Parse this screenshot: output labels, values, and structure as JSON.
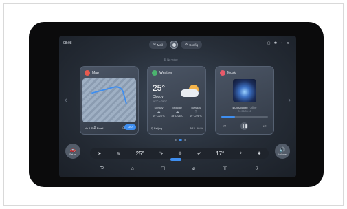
{
  "status": {
    "time": "08:08",
    "system_icons": "▢ ✱ ◔ ≋"
  },
  "top": {
    "mail_label": "Mail",
    "config_label": "Config"
  },
  "voice": {
    "hint": "No voice"
  },
  "map": {
    "title": "Map",
    "destination": "No.1 Sun Road",
    "go_label": "GO"
  },
  "weather": {
    "title": "Weather",
    "temp": "25°",
    "condition": "Cloudy",
    "range": "18°C ~ 28°C",
    "days": [
      {
        "name": "Sunday",
        "sym": "☁",
        "range": "19°C/24°C"
      },
      {
        "name": "Monday",
        "sym": "☁",
        "range": "18°C/26°C"
      },
      {
        "name": "Tuesday",
        "sym": "☂",
        "range": "19°C/26°C"
      }
    ],
    "city": "Beijing",
    "date": "2/12",
    "clock": "18:54"
  },
  "music": {
    "title": "Music",
    "song": "EuroDancer",
    "artist": "- Alive",
    "sub": "01:52/03:16"
  },
  "left_round": {
    "label": "Get on"
  },
  "right_round": {
    "label": "Volume"
  },
  "dock": {
    "temp_left": "25°",
    "temp_right": "17°"
  },
  "colors": {
    "accent": "#3e8ef0",
    "card": "#3a4350"
  }
}
